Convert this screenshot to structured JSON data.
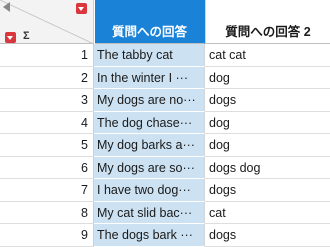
{
  "columns": {
    "selected_header": "質問への回答",
    "second_header": "質問への回答 2"
  },
  "corner": {
    "sigma": "Σ",
    "icons": [
      "left-arrow-icon",
      "column-menu-icon",
      "row-menu-icon",
      "sigma-icon"
    ]
  },
  "colors": {
    "selected_header_bg": "#1a83d8",
    "selected_cell_bg": "#cce2f3",
    "menu_button": "#d9363e"
  },
  "rows": [
    {
      "num": "1",
      "col1": "The tabby cat",
      "col2": "cat cat"
    },
    {
      "num": "2",
      "col1": "In the winter I ···",
      "col2": "dog"
    },
    {
      "num": "3",
      "col1": "My dogs are no···",
      "col2": "dogs"
    },
    {
      "num": "4",
      "col1": "The dog chase···",
      "col2": "dog"
    },
    {
      "num": "5",
      "col1": "My dog barks a···",
      "col2": "dog"
    },
    {
      "num": "6",
      "col1": "My dogs are so···",
      "col2": "dogs dog"
    },
    {
      "num": "7",
      "col1": "I have two dog···",
      "col2": "dogs"
    },
    {
      "num": "8",
      "col1": "My cat slid bac···",
      "col2": "cat"
    },
    {
      "num": "9",
      "col1": "The dogs bark ···",
      "col2": "dogs"
    }
  ]
}
